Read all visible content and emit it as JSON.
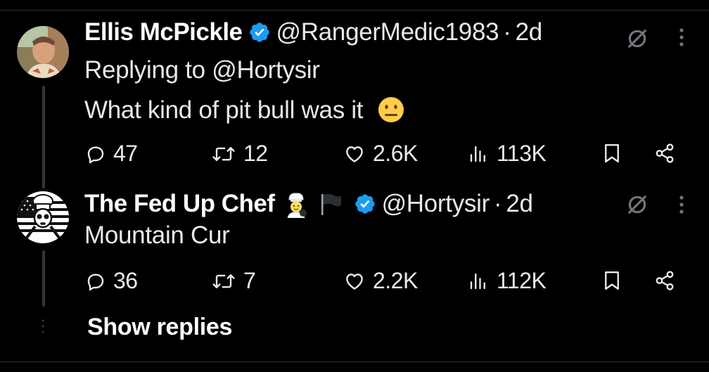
{
  "tweets": [
    {
      "author_name": "Ellis McPickle",
      "handle": "@RangerMedic1983",
      "separator": "·",
      "time": "2d",
      "reply_prefix": "Replying to ",
      "reply_to": "@Hortysir",
      "text": "What kind of pit bull was it",
      "emoji": "neutral-face-emoji",
      "verified": true,
      "stats": {
        "replies": "47",
        "reposts": "12",
        "likes": "2.6K",
        "views": "113K"
      }
    },
    {
      "author_name": "The Fed Up Chef",
      "handle": "@Hortysir",
      "separator": "·",
      "time": "2d",
      "name_emojis": [
        "cook-emoji",
        "black-flag-emoji"
      ],
      "text": "Mountain Cur",
      "verified": true,
      "stats": {
        "replies": "36",
        "reposts": "7",
        "likes": "2.2K",
        "views": "112K"
      }
    }
  ],
  "show_replies_label": "Show replies",
  "colors": {
    "background": "#000000",
    "text": "#e7e9ea",
    "verified": "#1d9bf0",
    "divider": "#2f3336"
  },
  "icons": [
    "reply-icon",
    "repost-icon",
    "like-icon",
    "views-icon",
    "bookmark-icon",
    "share-icon",
    "grok-icon",
    "more-icon"
  ]
}
